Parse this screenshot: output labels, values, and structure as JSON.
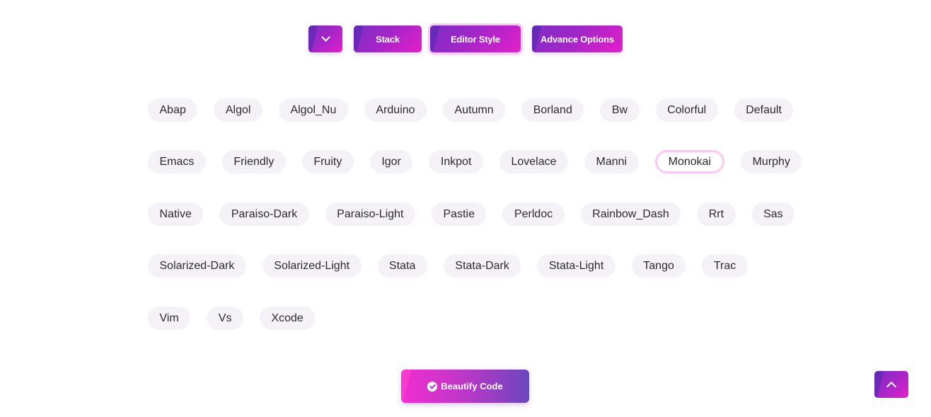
{
  "toolbar": {
    "toggle_icon": "chevron-down-icon",
    "stack_label": "Stack",
    "editor_style_label": "Editor Style",
    "advance_options_label": "Advance Options"
  },
  "styles": {
    "selected": "Monokai",
    "rows": [
      [
        "Abap",
        "Algol",
        "Algol_Nu",
        "Arduino",
        "Autumn",
        "Borland",
        "Bw",
        "Colorful",
        "Default"
      ],
      [
        "Emacs",
        "Friendly",
        "Fruity",
        "Igor",
        "Inkpot",
        "Lovelace",
        "Manni",
        "Monokai",
        "Murphy"
      ],
      [
        "Native",
        "Paraiso-Dark",
        "Paraiso-Light",
        "Pastie",
        "Perldoc",
        "Rainbow_Dash",
        "Rrt",
        "Sas"
      ],
      [
        "Solarized-Dark",
        "Solarized-Light",
        "Stata",
        "Stata-Dark",
        "Stata-Light",
        "Tango",
        "Trac"
      ],
      [
        "Vim",
        "Vs",
        "Xcode"
      ]
    ]
  },
  "beautify": {
    "label": "Beautify Code",
    "icon": "check-circle-icon"
  },
  "scroll_top": {
    "icon": "chevron-up-icon"
  },
  "colors": {
    "accent_purple": "#7c2ec6",
    "accent_pink": "#e51fca",
    "chip_bg": "#f4f2f7",
    "chip_selected_border": "#fbc8f6"
  }
}
